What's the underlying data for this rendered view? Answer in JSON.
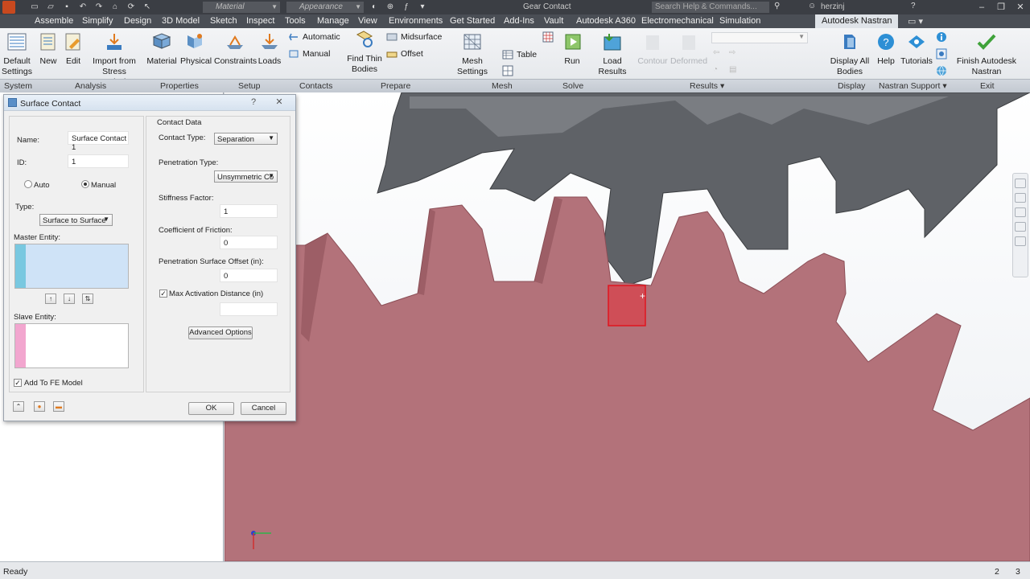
{
  "titlebar": {
    "material_placeholder": "Material",
    "appearance_placeholder": "Appearance",
    "document_title": "Gear Contact",
    "search_placeholder": "Search Help & Commands...",
    "user": "herzinj"
  },
  "tabs": [
    "Assemble",
    "Simplify",
    "Design",
    "3D Model",
    "Sketch",
    "Inspect",
    "Tools",
    "Manage",
    "View",
    "Environments",
    "Get Started",
    "Add-Ins",
    "Vault",
    "Autodesk A360",
    "Electromechanical",
    "Simulation",
    "Autodesk Nastran"
  ],
  "active_tab": "Autodesk Nastran",
  "ribbon": {
    "default_settings": "Default Settings",
    "new": "New",
    "edit": "Edit",
    "import_stress": "Import from Stress Analysis",
    "material": "Material",
    "physical": "Physical",
    "constraints": "Constraints",
    "loads": "Loads",
    "automatic": "Automatic",
    "manual": "Manual",
    "find_thin_bodies": "Find Thin Bodies",
    "midsurface": "Midsurface",
    "offset": "Offset",
    "mesh_settings": "Mesh Settings",
    "table": "Table",
    "run": "Run",
    "load_results": "Load Results",
    "contour": "Contour",
    "deformed": "Deformed",
    "display_all_bodies": "Display All Bodies",
    "help": "Help",
    "tutorials": "Tutorials",
    "finish_nastran": "Finish Autodesk Nastran"
  },
  "panels": {
    "system": "System",
    "analysis": "Analysis",
    "properties": "Properties",
    "setup": "Setup",
    "contacts": "Contacts",
    "prepare": "Prepare",
    "mesh": "Mesh",
    "solve": "Solve",
    "results": "Results",
    "display": "Display",
    "nastran_support": "Nastran Support",
    "exit": "Exit"
  },
  "dialog": {
    "title": "Surface Contact",
    "name_label": "Name:",
    "name_value": "Surface Contact 1",
    "id_label": "ID:",
    "id_value": "1",
    "auto_label": "Auto",
    "manual_label": "Manual",
    "type_label": "Type:",
    "type_value": "Surface to Surface",
    "master_label": "Master Entity:",
    "slave_label": "Slave Entity:",
    "add_fe_label": "Add To FE Model",
    "contact_data_label": "Contact Data",
    "contact_type_label": "Contact Type:",
    "contact_type_value": "Separation",
    "penetration_type_label": "Penetration Type:",
    "penetration_type_value": "Unsymmetric Co",
    "stiffness_label": "Stiffness Factor:",
    "stiffness_value": "1",
    "friction_label": "Coefficient of Friction:",
    "friction_value": "0",
    "pen_offset_label": "Penetration Surface Offset (in):",
    "pen_offset_value": "0",
    "max_activation_label": "Max Activation Distance (in)",
    "max_activation_value": "",
    "advanced_label": "Advanced Options",
    "ok_label": "OK",
    "cancel_label": "Cancel"
  },
  "status": {
    "text": "Ready",
    "count1": "2",
    "count2": "3"
  },
  "colors": {
    "ribbon_accent": "#2d8fd5",
    "gear_top": "#6b6e73",
    "gear_bottom": "#b5757c",
    "selected_face": "#d8434c"
  }
}
